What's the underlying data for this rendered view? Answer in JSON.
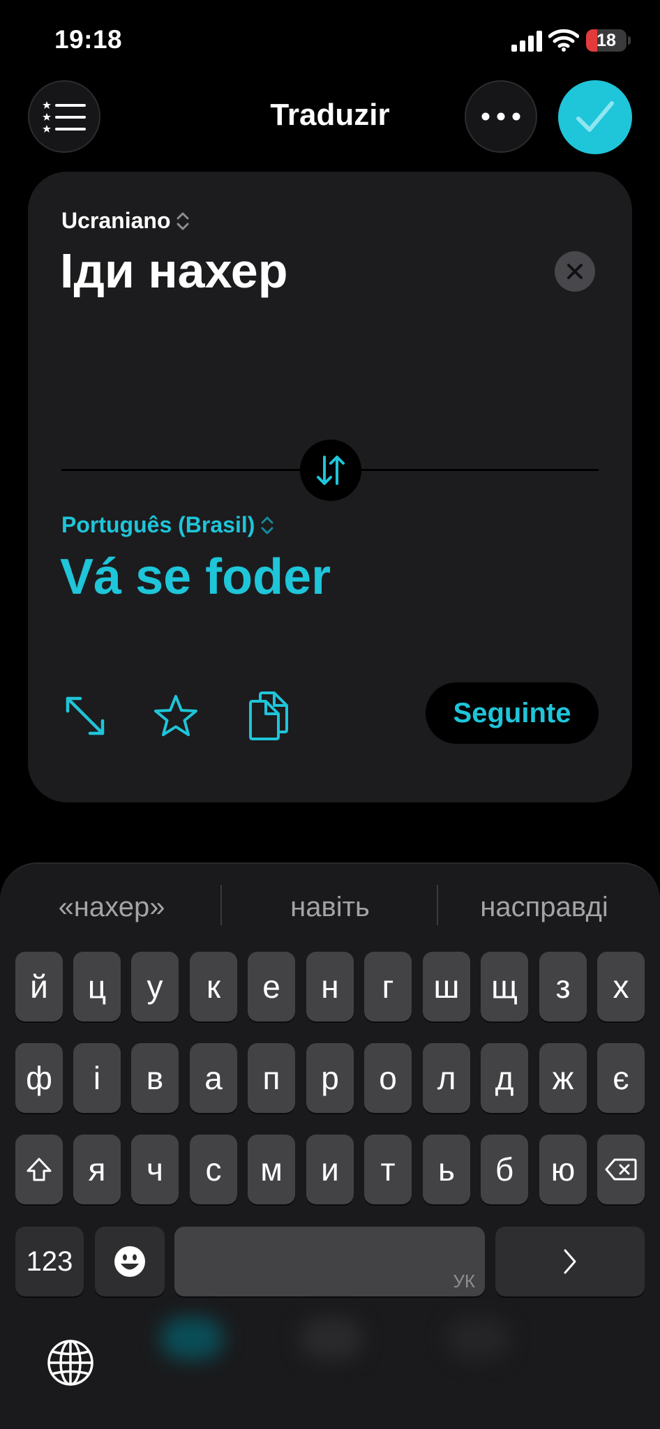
{
  "status": {
    "time": "19:18",
    "battery": "18"
  },
  "header": {
    "title": "Traduzir"
  },
  "source": {
    "language": "Ucraniano",
    "text": "Іди нахер"
  },
  "target": {
    "language": "Português (Brasil)",
    "text": "Vá se foder"
  },
  "actions": {
    "next_label": "Seguinte"
  },
  "colors": {
    "accent": "#1fc5d9",
    "card": "#1c1c1e",
    "key": "#434346",
    "battery_low": "#e33b3b"
  },
  "keyboard": {
    "suggestions": [
      "«нахер»",
      "навіть",
      "насправді"
    ],
    "row1": [
      "й",
      "ц",
      "у",
      "к",
      "е",
      "н",
      "г",
      "ш",
      "щ",
      "з",
      "х"
    ],
    "row2": [
      "ф",
      "і",
      "в",
      "а",
      "п",
      "р",
      "о",
      "л",
      "д",
      "ж",
      "є"
    ],
    "row3": [
      "я",
      "ч",
      "с",
      "м",
      "и",
      "т",
      "ь",
      "б",
      "ю"
    ],
    "numbers_label": "123",
    "space_tag": "УК",
    "icons": [
      "shift-icon",
      "backspace-icon",
      "emoji-icon",
      "return-chevron-icon",
      "globe-icon"
    ]
  }
}
